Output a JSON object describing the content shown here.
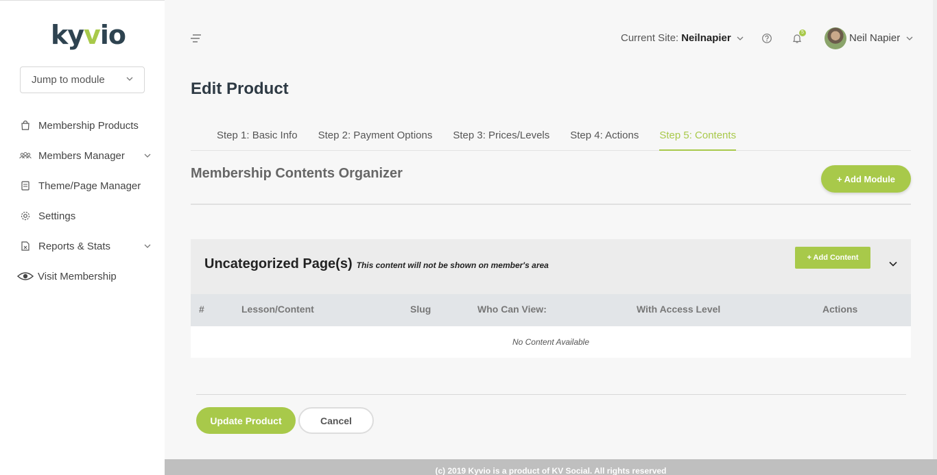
{
  "brand": {
    "logo_prefix": "ky",
    "logo_accent": "v",
    "logo_suffix": "io",
    "accent_color": "#a8c94a"
  },
  "sidebar": {
    "jump_label": "Jump to module",
    "items": [
      {
        "label": "Membership Products",
        "icon": "shopping-bag-icon"
      },
      {
        "label": "Members Manager",
        "icon": "users-icon",
        "expandable": true
      },
      {
        "label": "Theme/Page Manager",
        "icon": "page-icon"
      },
      {
        "label": "Settings",
        "icon": "gear-icon"
      },
      {
        "label": "Reports & Stats",
        "icon": "spreadsheet-icon",
        "expandable": true
      },
      {
        "label": "Visit Membership",
        "icon": "eye-icon"
      }
    ]
  },
  "topbar": {
    "site_label": "Current Site:",
    "site_value": "Neilnapier",
    "notification_count": "5",
    "user_name": "Neil Napier"
  },
  "page": {
    "title": "Edit Product",
    "tabs": [
      {
        "label": "Step 1: Basic Info"
      },
      {
        "label": "Step 2: Payment Options"
      },
      {
        "label": "Step 3: Prices/Levels"
      },
      {
        "label": "Step 4: Actions"
      },
      {
        "label": "Step 5: Contents",
        "active": true
      }
    ],
    "section_title": "Membership Contents Organizer",
    "add_module_label": "+ Add Module",
    "category": {
      "title": "Uncategorized Page(s)",
      "note": "This content will not be shown on member's area",
      "add_content_label": "+ Add Content"
    },
    "table": {
      "columns": [
        "#",
        "Lesson/Content",
        "Slug",
        "Who Can View:",
        "With Access Level",
        "Actions"
      ],
      "empty_text": "No Content Available"
    },
    "update_label": "Update Product",
    "cancel_label": "Cancel"
  },
  "footer": {
    "text": "(c) 2019 Kyvio is a product of KV Social. All rights reserved"
  }
}
